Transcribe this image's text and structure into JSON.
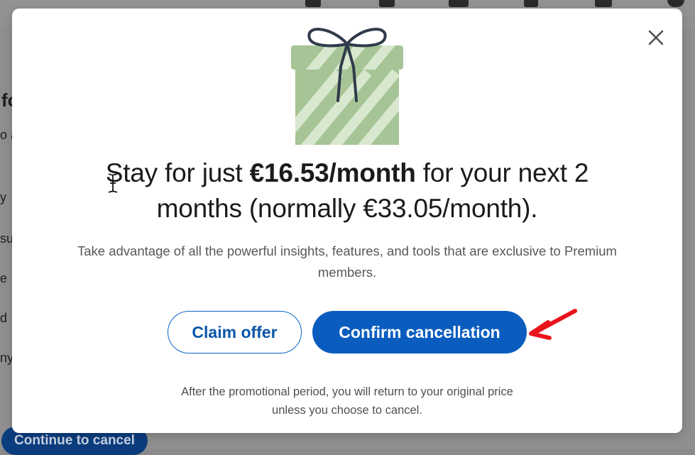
{
  "background": {
    "side_text": [
      "fo",
      "o a",
      "y",
      "su",
      "e",
      "d",
      "ny"
    ],
    "continue_button": "Continue to cancel"
  },
  "modal": {
    "close_icon": "close-icon",
    "gift_icon": "gift-box-icon",
    "headline": {
      "part1": "Stay for just ",
      "price_bold": "€16.53/month",
      "part2": " for your next 2 months (normally €33.05/month)."
    },
    "description": "Take advantage of all the powerful insights, features, and tools that are exclusive to Premium members.",
    "buttons": {
      "claim": "Claim offer",
      "confirm": "Confirm cancellation"
    },
    "footnote": "After the promotional period, you will return to your original price unless you choose to cancel."
  },
  "colors": {
    "primary": "#0a5dbf",
    "annotation_arrow": "#e8141c",
    "gift_green": "#a9c89a"
  }
}
